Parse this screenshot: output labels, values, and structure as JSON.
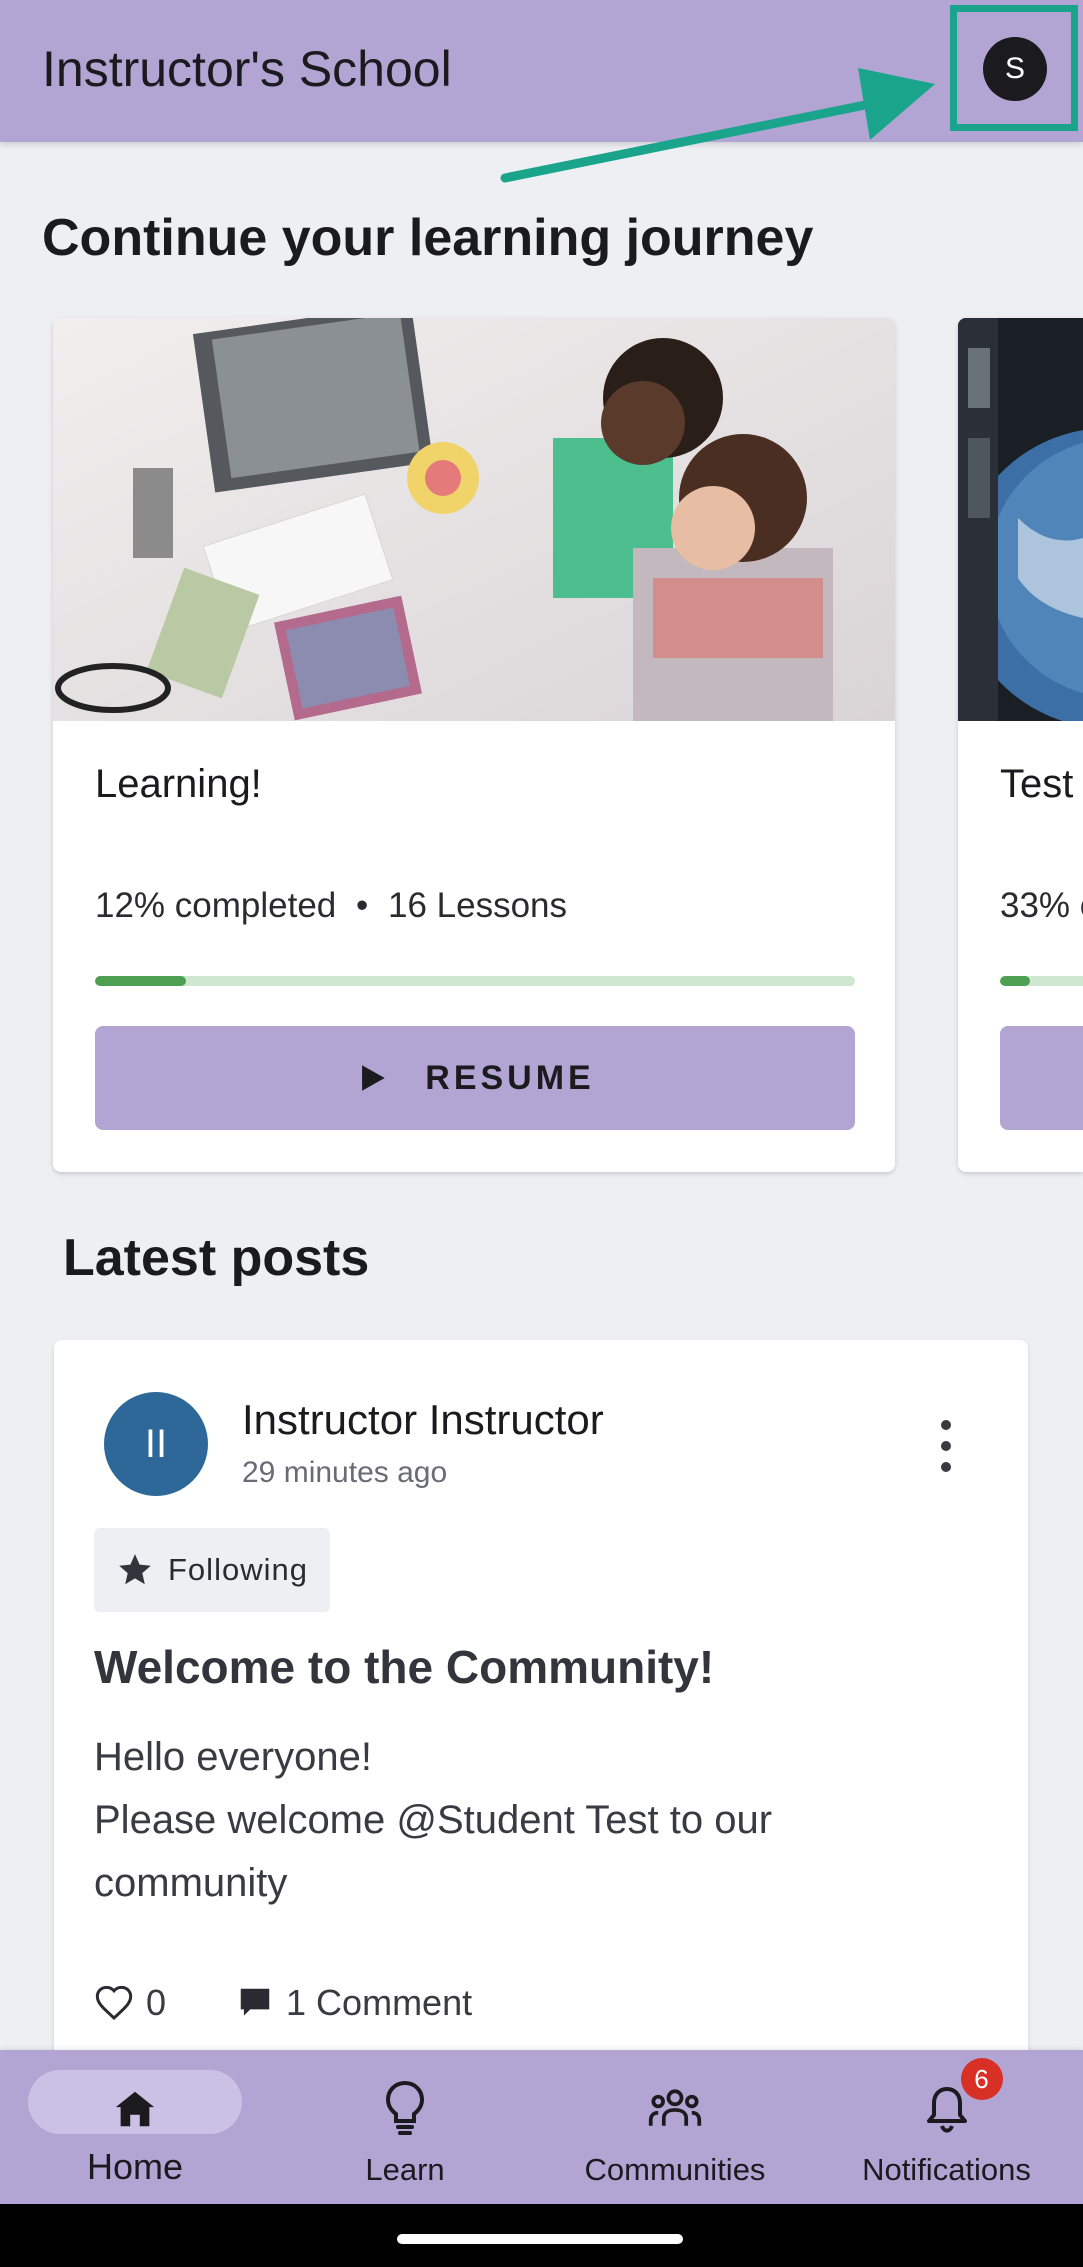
{
  "header": {
    "title": "Instructor's School",
    "avatar_initial": "S",
    "highlight_color": "#1aa48c"
  },
  "continue_section": {
    "title": "Continue your learning journey",
    "cards": [
      {
        "title": "Learning!",
        "progress_text": "12% completed",
        "lessons_text": "16 Lessons",
        "separator": "•",
        "progress": 0.12,
        "button_label": "RESUME",
        "image": "people-working-at-design-desk"
      },
      {
        "title": "Test",
        "progress_text": "33% c",
        "progress": 0.33,
        "image": "space-station-earth-view"
      }
    ]
  },
  "posts_section": {
    "title": "Latest posts",
    "post": {
      "author_initials": "II",
      "author": "Instructor Instructor",
      "time": "29 minutes ago",
      "chip_label": "Following",
      "title": "Welcome to the Community!",
      "body_lines": [
        "Hello everyone!",
        "Please welcome @Student Test to our",
        "community"
      ],
      "likes": "0",
      "comments": "1 Comment"
    }
  },
  "bottom_nav": {
    "items": [
      {
        "label": "Home",
        "icon": "home-icon",
        "active": true
      },
      {
        "label": "Learn",
        "icon": "lightbulb-icon"
      },
      {
        "label": "Communities",
        "icon": "communities-icon"
      },
      {
        "label": "Notifications",
        "icon": "bell-icon",
        "badge": "6"
      }
    ]
  },
  "colors": {
    "header_bg": "#b2a5d4",
    "progress_fill": "#4f9f52",
    "post_avatar_bg": "#2d6899",
    "badge_bg": "#d93025"
  }
}
